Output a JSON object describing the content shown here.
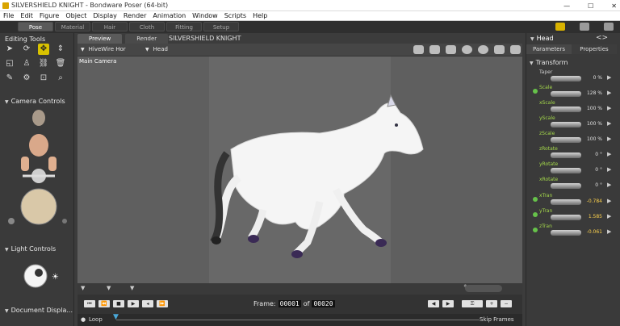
{
  "window": {
    "title": "SILVERSHIELD KNIGHT - Bondware Poser (64-bit)",
    "controls": [
      "—",
      "☐",
      "✕"
    ]
  },
  "menu": [
    "File",
    "Edit",
    "Figure",
    "Object",
    "Display",
    "Render",
    "Animation",
    "Window",
    "Scripts",
    "Help"
  ],
  "rooms": [
    {
      "label": "Pose",
      "active": true
    },
    {
      "label": "Material",
      "active": false
    },
    {
      "label": "Hair",
      "active": false
    },
    {
      "label": "Cloth",
      "active": false
    },
    {
      "label": "Fitting",
      "active": false
    },
    {
      "label": "Setup",
      "active": false
    }
  ],
  "left": {
    "editing_tools": "Editing Tools",
    "camera_controls": "Camera Controls",
    "light_controls": "Light Controls",
    "document_display": "Document Displa..."
  },
  "viewport": {
    "tabs": [
      "Preview",
      "Render"
    ],
    "scene_title": "SILVERSHIELD KNIGHT",
    "figure_select": "HiveWire Hor",
    "part_select": "Head",
    "camera_label": "Main Camera"
  },
  "animation": {
    "frame_label": "Frame:",
    "current_frame": "00001",
    "of_label": "of",
    "total_frames": "00020",
    "loop_label": "Loop",
    "skip_label": "Skip Frames"
  },
  "parameters": {
    "title": "Head",
    "tabs": [
      "Parameters",
      "Properties"
    ],
    "group": "Transform",
    "items": [
      {
        "name": "Taper",
        "value": "0 %",
        "dot": false,
        "keyed": false
      },
      {
        "name": "Scale",
        "value": "128 %",
        "dot": true,
        "keyed": true
      },
      {
        "name": "xScale",
        "value": "100 %",
        "dot": false,
        "keyed": true
      },
      {
        "name": "yScale",
        "value": "100 %",
        "dot": false,
        "keyed": true
      },
      {
        "name": "zScale",
        "value": "100 %",
        "dot": false,
        "keyed": true
      },
      {
        "name": "zRotate",
        "value": "0 °",
        "dot": false,
        "keyed": true
      },
      {
        "name": "yRotate",
        "value": "0 °",
        "dot": false,
        "keyed": true
      },
      {
        "name": "xRotate",
        "value": "0 °",
        "dot": false,
        "keyed": true
      },
      {
        "name": "xTran",
        "value": "-0.784",
        "dot": true,
        "keyed": true
      },
      {
        "name": "yTran",
        "value": "1.585",
        "dot": true,
        "keyed": true
      },
      {
        "name": "zTran",
        "value": "-0.061",
        "dot": true,
        "keyed": true
      }
    ]
  }
}
